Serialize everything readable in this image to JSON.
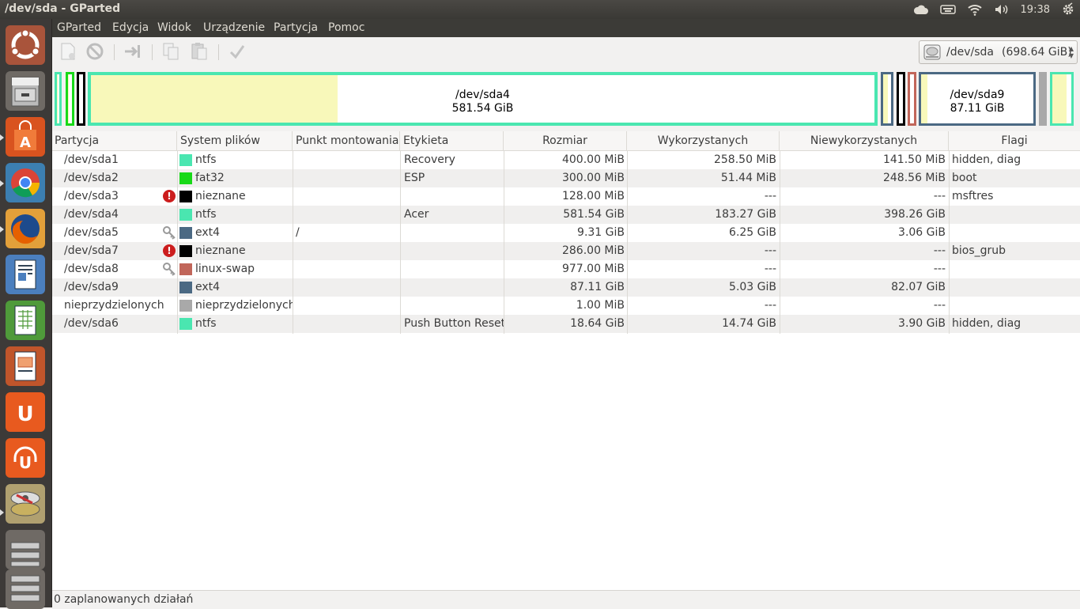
{
  "window": {
    "title": "/dev/sda - GParted"
  },
  "panel": {
    "clock": "19:38"
  },
  "menu": [
    "GParted",
    "Edycja",
    "Widok",
    "Urządzenie",
    "Partycja",
    "Pomoc"
  ],
  "device": {
    "name": "/dev/sda",
    "size": "(698.64 GiB)"
  },
  "map": {
    "sda4": {
      "name": "/dev/sda4",
      "size": "581.54 GiB",
      "used_fraction": 0.315
    },
    "sda9": {
      "name": "/dev/sda9",
      "size": "87.11 GiB",
      "used_fraction": 0.058
    }
  },
  "columns": [
    "Partycja",
    "System plików",
    "Punkt montowania",
    "Etykieta",
    "Rozmiar",
    "Wykorzystanych",
    "Niewykorzystanych",
    "Flagi"
  ],
  "rows": [
    {
      "partition": "/dev/sda1",
      "fs": "ntfs",
      "fs_color": "#4ae6b0",
      "mount": "",
      "label": "Recovery",
      "size": "400.00 MiB",
      "used": "258.50 MiB",
      "unused": "141.50 MiB",
      "flags": "hidden, diag",
      "icon": ""
    },
    {
      "partition": "/dev/sda2",
      "fs": "fat32",
      "fs_color": "#18d918",
      "mount": "",
      "label": "ESP",
      "size": "300.00 MiB",
      "used": "51.44 MiB",
      "unused": "248.56 MiB",
      "flags": "boot",
      "icon": ""
    },
    {
      "partition": "/dev/sda3",
      "fs": "nieznane",
      "fs_color": "#000000",
      "mount": "",
      "label": "",
      "size": "128.00 MiB",
      "used": "---",
      "unused": "---",
      "flags": "msftres",
      "icon": "warning"
    },
    {
      "partition": "/dev/sda4",
      "fs": "ntfs",
      "fs_color": "#4ae6b0",
      "mount": "",
      "label": "Acer",
      "size": "581.54 GiB",
      "used": "183.27 GiB",
      "unused": "398.26 GiB",
      "flags": "",
      "icon": ""
    },
    {
      "partition": "/dev/sda5",
      "fs": "ext4",
      "fs_color": "#4b6983",
      "mount": "/",
      "label": "",
      "size": "9.31 GiB",
      "used": "6.25 GiB",
      "unused": "3.06 GiB",
      "flags": "",
      "icon": "key"
    },
    {
      "partition": "/dev/sda7",
      "fs": "nieznane",
      "fs_color": "#000000",
      "mount": "",
      "label": "",
      "size": "286.00 MiB",
      "used": "---",
      "unused": "---",
      "flags": "bios_grub",
      "icon": "warning"
    },
    {
      "partition": "/dev/sda8",
      "fs": "linux-swap",
      "fs_color": "#c1665a",
      "mount": "",
      "label": "",
      "size": "977.00 MiB",
      "used": "---",
      "unused": "---",
      "flags": "",
      "icon": "key"
    },
    {
      "partition": "/dev/sda9",
      "fs": "ext4",
      "fs_color": "#4b6983",
      "mount": "",
      "label": "",
      "size": "87.11 GiB",
      "used": "5.03 GiB",
      "unused": "82.07 GiB",
      "flags": "",
      "icon": ""
    },
    {
      "partition": "nieprzydzielonych",
      "fs": "nieprzydzielonych",
      "fs_color": "#a9a9a9",
      "mount": "",
      "label": "",
      "size": "1.00 MiB",
      "used": "---",
      "unused": "---",
      "flags": "",
      "icon": ""
    },
    {
      "partition": "/dev/sda6",
      "fs": "ntfs",
      "fs_color": "#4ae6b0",
      "mount": "",
      "label": "Push Button Reset",
      "size": "18.64 GiB",
      "used": "14.74 GiB",
      "unused": "3.90 GiB",
      "flags": "hidden, diag",
      "icon": ""
    }
  ],
  "status": "0 zaplanowanych działań",
  "colors": {
    "ntfs": "#4ae6b0",
    "fat32": "#18d918",
    "unknown": "#000000",
    "ext4": "#4b6983",
    "swap": "#c1665a",
    "unallocated": "#a9a9a9",
    "used": "#f8f8ba",
    "selection": "#4ae6b0"
  }
}
